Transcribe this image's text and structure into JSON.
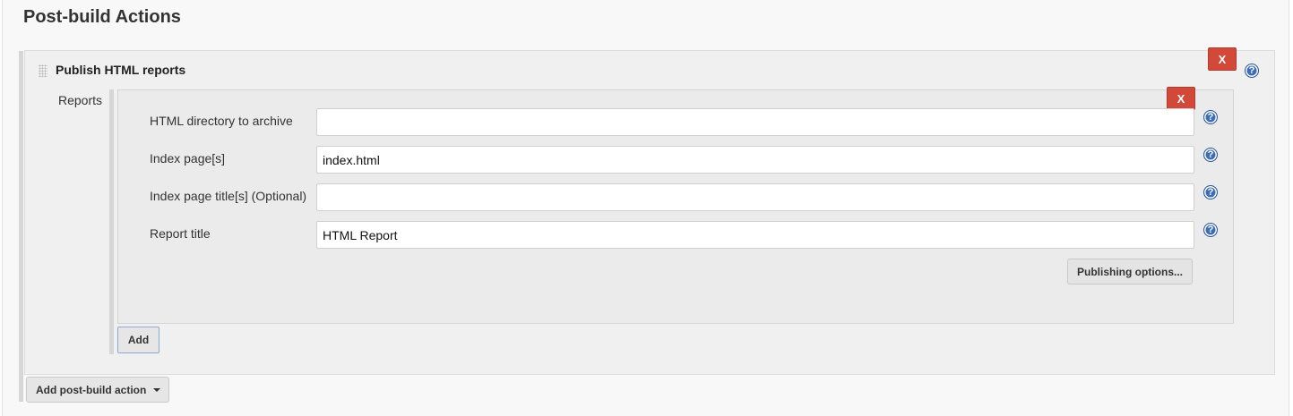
{
  "section": {
    "title": "Post-build Actions"
  },
  "step": {
    "title": "Publish HTML reports",
    "delete_label": "X",
    "help_label": "?"
  },
  "reports": {
    "label": "Reports",
    "delete_label": "X",
    "fields": [
      {
        "label": "HTML directory to archive",
        "value": "",
        "help": "?"
      },
      {
        "label": "Index page[s]",
        "value": "index.html",
        "help": "?"
      },
      {
        "label": "Index page title[s] (Optional)",
        "value": "",
        "help": "?"
      },
      {
        "label": "Report title",
        "value": "HTML Report",
        "help": "?"
      }
    ],
    "publishing_options_label": "Publishing options...",
    "add_label": "Add"
  },
  "footer": {
    "add_post_build_action_label": "Add post-build action"
  },
  "colors": {
    "delete_button": "#d24939",
    "help_icon": "#3d6db5",
    "panel_bg": "#f0f0f0"
  }
}
